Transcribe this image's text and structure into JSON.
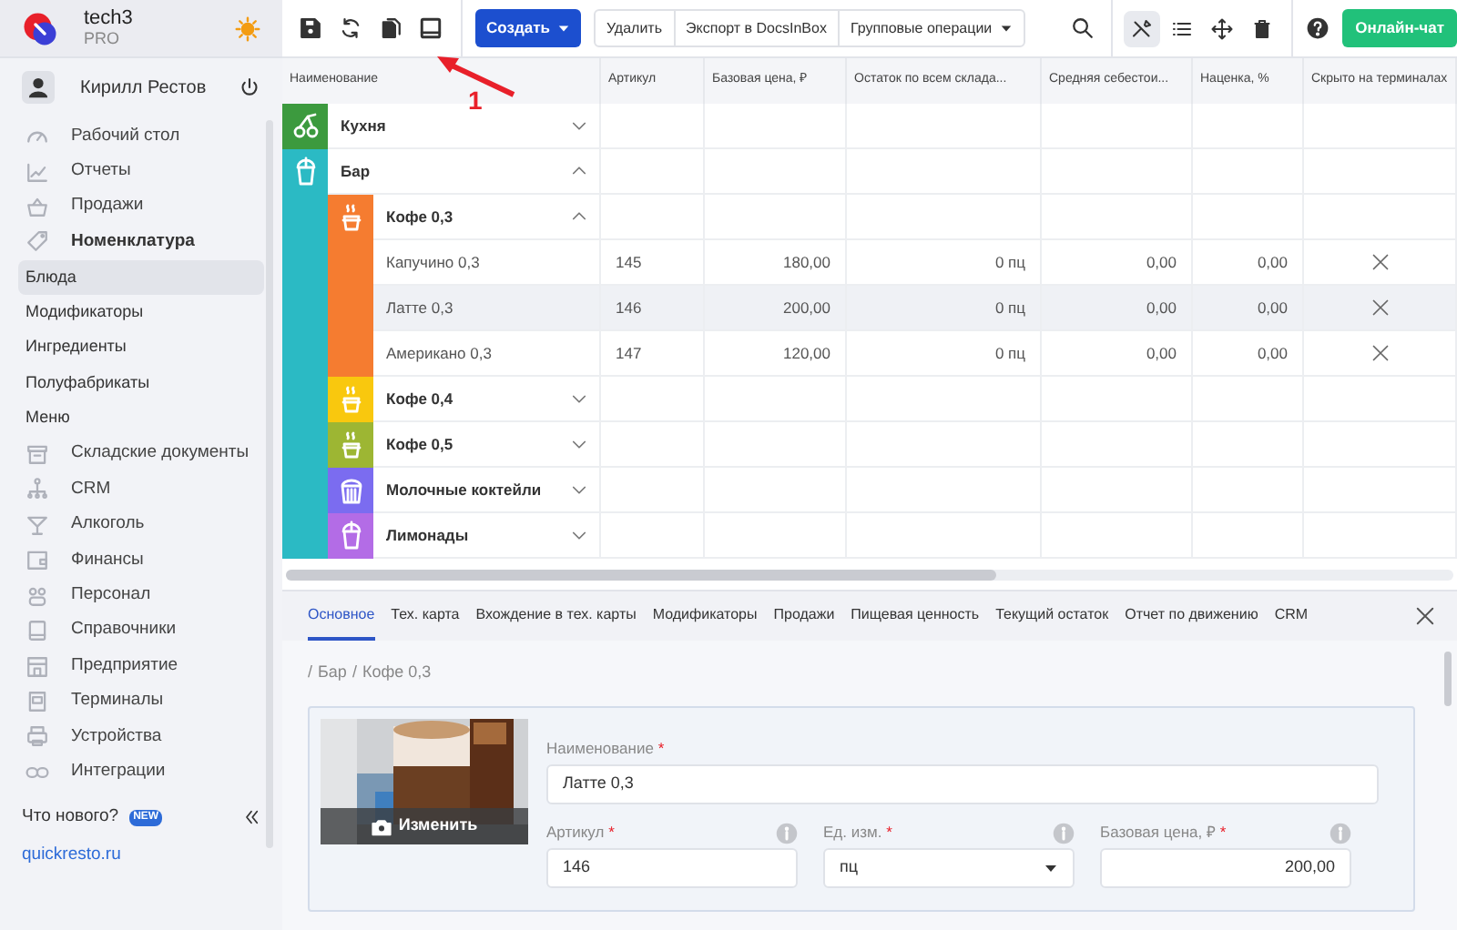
{
  "sidebar": {
    "brand": "tech3",
    "plan": "PRO",
    "user": "Кирилл Рестов",
    "items": [
      {
        "label": "Рабочий стол",
        "selected": false
      },
      {
        "label": "Отчеты",
        "selected": false
      },
      {
        "label": "Продажи",
        "selected": false
      },
      {
        "label": "Номенклатура",
        "selected": false,
        "expanded": true,
        "children": [
          {
            "label": "Блюда",
            "selected": true
          },
          {
            "label": "Модификаторы",
            "selected": false
          },
          {
            "label": "Ингредиенты",
            "selected": false
          },
          {
            "label": "Полуфабрикаты",
            "selected": false
          },
          {
            "label": "Меню",
            "selected": false
          }
        ]
      },
      {
        "label": "Складские документы",
        "selected": false
      },
      {
        "label": "CRM",
        "selected": false
      },
      {
        "label": "Алкоголь",
        "selected": false
      },
      {
        "label": "Финансы",
        "selected": false
      },
      {
        "label": "Персонал",
        "selected": false
      },
      {
        "label": "Справочники",
        "selected": false
      },
      {
        "label": "Предприятие",
        "selected": false
      },
      {
        "label": "Терминалы",
        "selected": false
      },
      {
        "label": "Устройства",
        "selected": false
      },
      {
        "label": "Интеграции",
        "selected": false
      }
    ],
    "whats_new": "Что нового?",
    "new_badge": "NEW",
    "site_link": "quickresto.ru"
  },
  "toolbar": {
    "create_button": "Создать",
    "actions": [
      "Удалить",
      "Экспорт в DocsInBox",
      "Групповые операции"
    ],
    "chat_button": "Онлайн-чат"
  },
  "annotation": {
    "label": "1"
  },
  "table": {
    "columns": [
      "Наименование",
      "Артикул",
      "Базовая цена, ₽",
      "Остаток по всем склада...",
      "Средняя себестои...",
      "Наценка, %",
      "Скрыто на терминалах"
    ],
    "rows": [
      {
        "kind": "group",
        "name": "Кухня",
        "color": "#3c9a3e",
        "expanded": false
      },
      {
        "kind": "group",
        "name": "Бар",
        "color": "#2bbac4",
        "expanded": true,
        "children": [
          {
            "kind": "group",
            "name": "Кофе 0,3",
            "color": "#f57c30",
            "expanded": true,
            "children": [
              {
                "kind": "item",
                "name": "Капучино 0,3",
                "selected": false,
                "cells": [
                  "145",
                  "180,00",
                  "0 пц",
                  "0,00",
                  "0,00"
                ],
                "hidden": true
              },
              {
                "kind": "item",
                "name": "Латте 0,3",
                "selected": true,
                "cells": [
                  "146",
                  "200,00",
                  "0 пц",
                  "0,00",
                  "0,00"
                ],
                "hidden": true
              },
              {
                "kind": "item",
                "name": "Американо 0,3",
                "selected": false,
                "cells": [
                  "147",
                  "120,00",
                  "0 пц",
                  "0,00",
                  "0,00"
                ],
                "hidden": true
              }
            ]
          },
          {
            "kind": "group",
            "name": "Кофе 0,4",
            "color": "#f9c80e",
            "expanded": false
          },
          {
            "kind": "group",
            "name": "Кофе 0,5",
            "color": "#9db633",
            "expanded": false
          },
          {
            "kind": "group",
            "name": "Молочные коктейли",
            "color": "#7b6cf0",
            "expanded": false
          },
          {
            "kind": "group",
            "name": "Лимонады",
            "color": "#b36ce6",
            "expanded": false
          }
        ]
      }
    ]
  },
  "detail": {
    "tabs": [
      {
        "label": "Основное",
        "selected": true
      },
      {
        "label": "Тех. карта",
        "selected": false
      },
      {
        "label": "Вхождение в тех. карты",
        "selected": false
      },
      {
        "label": "Модификаторы",
        "selected": false
      },
      {
        "label": "Продажи",
        "selected": false
      },
      {
        "label": "Пищевая ценность",
        "selected": false
      },
      {
        "label": "Текущий остаток",
        "selected": false
      },
      {
        "label": "Отчет по движению",
        "selected": false
      },
      {
        "label": "CRM",
        "selected": false
      }
    ],
    "breadcrumb": [
      {
        "separator": "/",
        "label": "Бар"
      },
      {
        "separator": "/",
        "label": "Кофе 0,3"
      }
    ],
    "photo_button": "Изменить",
    "fields": [
      {
        "kind": "text",
        "label": "Наименование",
        "marker": "*",
        "value": "Латте 0,3"
      },
      {
        "kind": "text",
        "label": "Артикул",
        "marker": "*",
        "value": "146",
        "info": true
      },
      {
        "kind": "select",
        "label": "Ед. изм.",
        "marker": "*",
        "value": "пц",
        "info": true
      },
      {
        "kind": "number",
        "label": "Базовая цена, ₽",
        "marker": "*",
        "value": "200,00",
        "info": true
      }
    ]
  }
}
